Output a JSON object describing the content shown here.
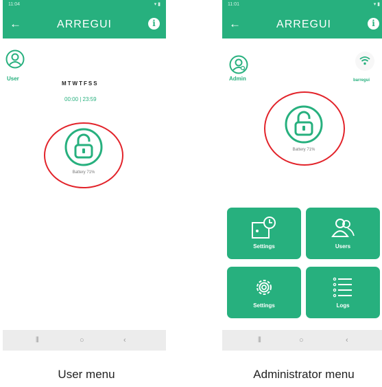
{
  "user_screen": {
    "status_time": "11:04",
    "logo": "ARREGUI",
    "role_label": "User",
    "days": "MTWTFSS",
    "schedule": "00:00 | 23:59",
    "battery": "Battery 71%",
    "caption": "User menu"
  },
  "admin_screen": {
    "status_time": "11:01",
    "logo": "ARREGUI",
    "role_label": "Admin",
    "wifi_name": "barregui",
    "battery": "Battery 71%",
    "tiles": [
      {
        "label": "Settings",
        "icon": "door-clock-icon"
      },
      {
        "label": "Users",
        "icon": "users-icon"
      },
      {
        "label": "Settings",
        "icon": "gear-icon"
      },
      {
        "label": "Logs",
        "icon": "list-icon"
      }
    ],
    "caption": "Administrator menu"
  },
  "colors": {
    "brand_green": "#27b07e",
    "highlight_red": "#e2232a",
    "navbar_gray": "#ececec"
  }
}
